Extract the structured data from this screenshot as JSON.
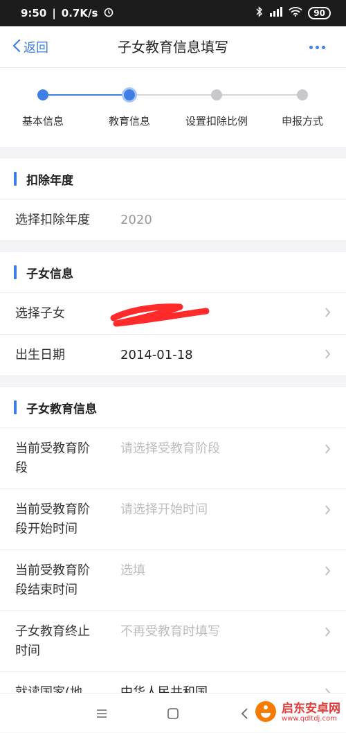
{
  "status": {
    "time": "9:50",
    "net_speed": "0.7K/s",
    "battery": "90"
  },
  "nav": {
    "back_label": "返回",
    "title": "子女教育信息填写"
  },
  "steps": [
    "基本信息",
    "教育信息",
    "设置扣除比例",
    "申报方式"
  ],
  "sections": {
    "year": {
      "title": "扣除年度",
      "rows": [
        {
          "label": "选择扣除年度",
          "value": "2020"
        }
      ]
    },
    "child": {
      "title": "子女信息",
      "rows": [
        {
          "label": "选择子女",
          "value": ""
        },
        {
          "label": "出生日期",
          "value": "2014-01-18"
        }
      ]
    },
    "edu": {
      "title": "子女教育信息",
      "rows": [
        {
          "label": "当前受教育阶段",
          "placeholder": "请选择受教育阶段"
        },
        {
          "label": "当前受教育阶段开始时间",
          "placeholder": "请选择开始时间"
        },
        {
          "label": "当前受教育阶段结束时间",
          "placeholder": "选填"
        },
        {
          "label": "子女教育终止时间",
          "placeholder": "不再受教育时填写"
        },
        {
          "label": "就读国家(地",
          "value": "中华人民共和国"
        }
      ]
    }
  },
  "watermark": {
    "name": "启东安卓网",
    "url": "www.qdltdj.com"
  },
  "colors": {
    "accent": "#3f7fe5",
    "inactive": "#c8c8cc"
  }
}
